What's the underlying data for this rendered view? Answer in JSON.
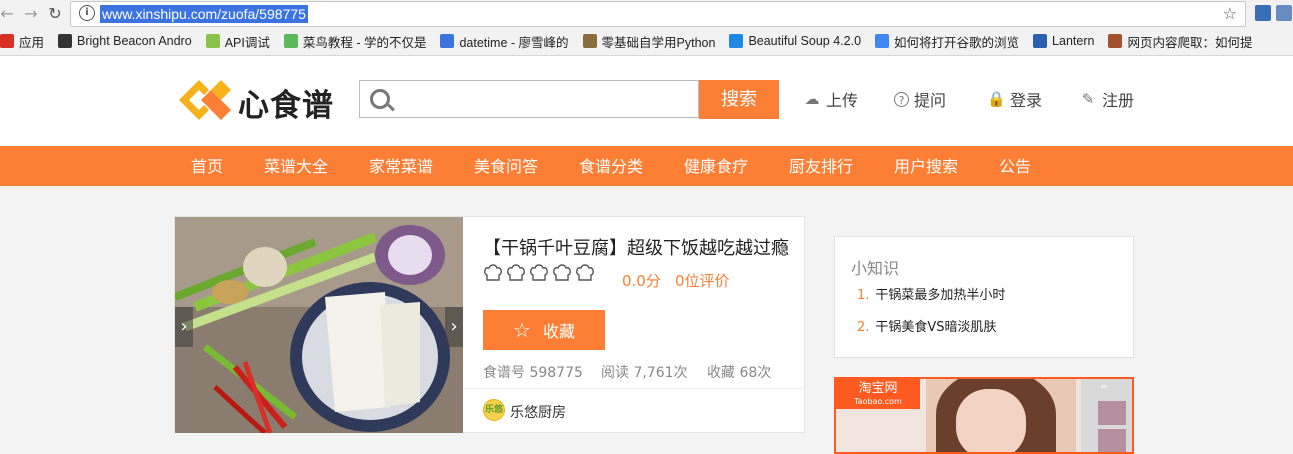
{
  "browser": {
    "url": "www.xinshipu.com/zuofa/598775",
    "bookmarks": [
      {
        "label": "应用",
        "icon": "apps-icon",
        "color": "#d93025"
      },
      {
        "label": "Bright Beacon Andro",
        "icon": "beacon-icon",
        "color": "#333333"
      },
      {
        "label": "API调试",
        "icon": "api-icon",
        "color": "#8bc34a"
      },
      {
        "label": "菜鸟教程 - 学的不仅是",
        "icon": "runoob-icon",
        "color": "#5cb85c"
      },
      {
        "label": "datetime - 廖雪峰的",
        "icon": "rocket-icon",
        "color": "#3b73e0"
      },
      {
        "label": "零基础自学用Python",
        "icon": "book-icon",
        "color": "#8a6d3b"
      },
      {
        "label": "Beautiful Soup 4.2.0",
        "icon": "c-icon",
        "color": "#1e88e5"
      },
      {
        "label": "如何将打开谷歌的浏览",
        "icon": "google-icon",
        "color": "#4285f4"
      },
      {
        "label": "Lantern",
        "icon": "lantern-icon",
        "color": "#2b5fae"
      },
      {
        "label": "网页内容爬取：如何提",
        "icon": "web-icon",
        "color": "#a0522d"
      }
    ]
  },
  "site": {
    "logo_text": "心食谱",
    "search_placeholder": "",
    "search_button": "搜索",
    "header_links": {
      "upload": "上传",
      "ask": "提问",
      "login": "登录",
      "register": "注册"
    },
    "nav": [
      "首页",
      "菜谱大全",
      "家常菜谱",
      "美食问答",
      "食谱分类",
      "健康食疗",
      "厨友排行",
      "用户搜索",
      "公告"
    ]
  },
  "recipe": {
    "title": "【干锅千叶豆腐】超级下饭越吃越过瘾",
    "rating_stars": 0,
    "score": "0.0分",
    "reviews": "0位评价",
    "favorite_button": "收藏",
    "meta": {
      "id": "食谱号 598775",
      "views": "阅读 7,761次",
      "favorites": "收藏 68次"
    },
    "author": "乐悠厨房",
    "author_avatar_text": "乐悠"
  },
  "tips": {
    "title": "小知识",
    "items": [
      {
        "num": "1.",
        "text": "干锅菜最多加热半小时"
      },
      {
        "num": "2.",
        "text": "干锅美食VS暗淡肌肤"
      }
    ]
  },
  "ad": {
    "logo": "淘宝网",
    "logo_sub": "Taobao.com"
  },
  "colors": {
    "accent": "#fd7e35"
  }
}
